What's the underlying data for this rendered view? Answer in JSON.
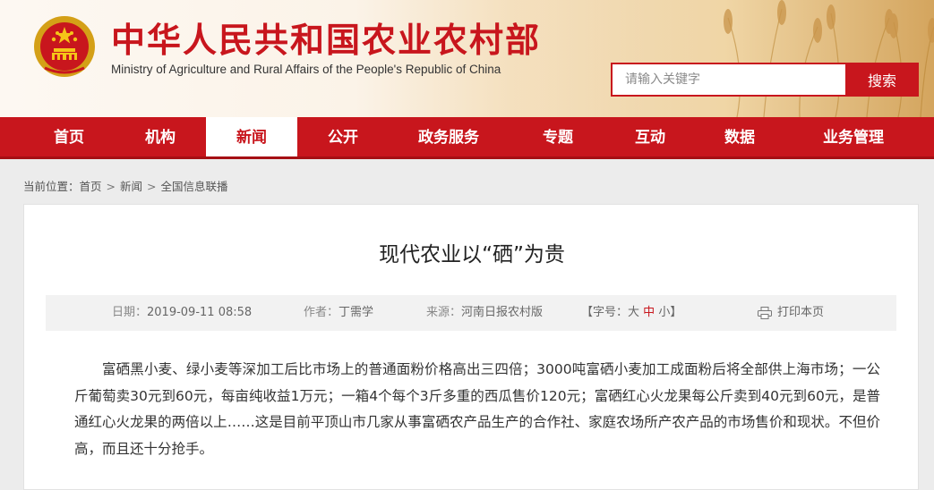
{
  "header": {
    "title": "中华人民共和国农业农村部",
    "subtitle": "Ministry of Agriculture and Rural Affairs of the People's Republic of China",
    "search": {
      "placeholder": "请输入关键字",
      "button_label": "搜索"
    }
  },
  "nav": {
    "items": [
      "首页",
      "机构",
      "新闻",
      "公开",
      "政务服务",
      "专题",
      "互动",
      "数据",
      "业务管理"
    ],
    "active": "新闻"
  },
  "breadcrumb": {
    "prefix": "当前位置：",
    "items": [
      "首页",
      "新闻",
      "全国信息联播"
    ],
    "separator": ">"
  },
  "article": {
    "title": "现代农业以“硒”为贵",
    "meta": {
      "date_label": "日期：",
      "date": "2019-09-11 08:58",
      "author_label": "作者：",
      "author": "丁需学",
      "source_label": "来源：",
      "source": "河南日报农村版",
      "font_size_label": "【字号：",
      "font_sizes": [
        "大",
        "中",
        "小"
      ],
      "font_size_close": "】",
      "print_label": "打印本页"
    },
    "body": "富硒黑小麦、绿小麦等深加工后比市场上的普通面粉价格高出三四倍；3000吨富硒小麦加工成面粉后将全部供上海市场；一公斤葡萄卖30元到60元，每亩纯收益1万元；一箱4个每个3斤多重的西瓜售价120元；富硒红心火龙果每公斤卖到40元到60元，是普通红心火龙果的两倍以上……这是目前平顶山市几家从事富硒农产品生产的合作社、家庭农场所产农产品的市场售价和现状。不但价高，而且还十分抢手。"
  },
  "colors": {
    "brand_red": "#c8161d",
    "nav_active_bg": "#ffffff",
    "meta_bar_bg": "#f2f2f2"
  }
}
